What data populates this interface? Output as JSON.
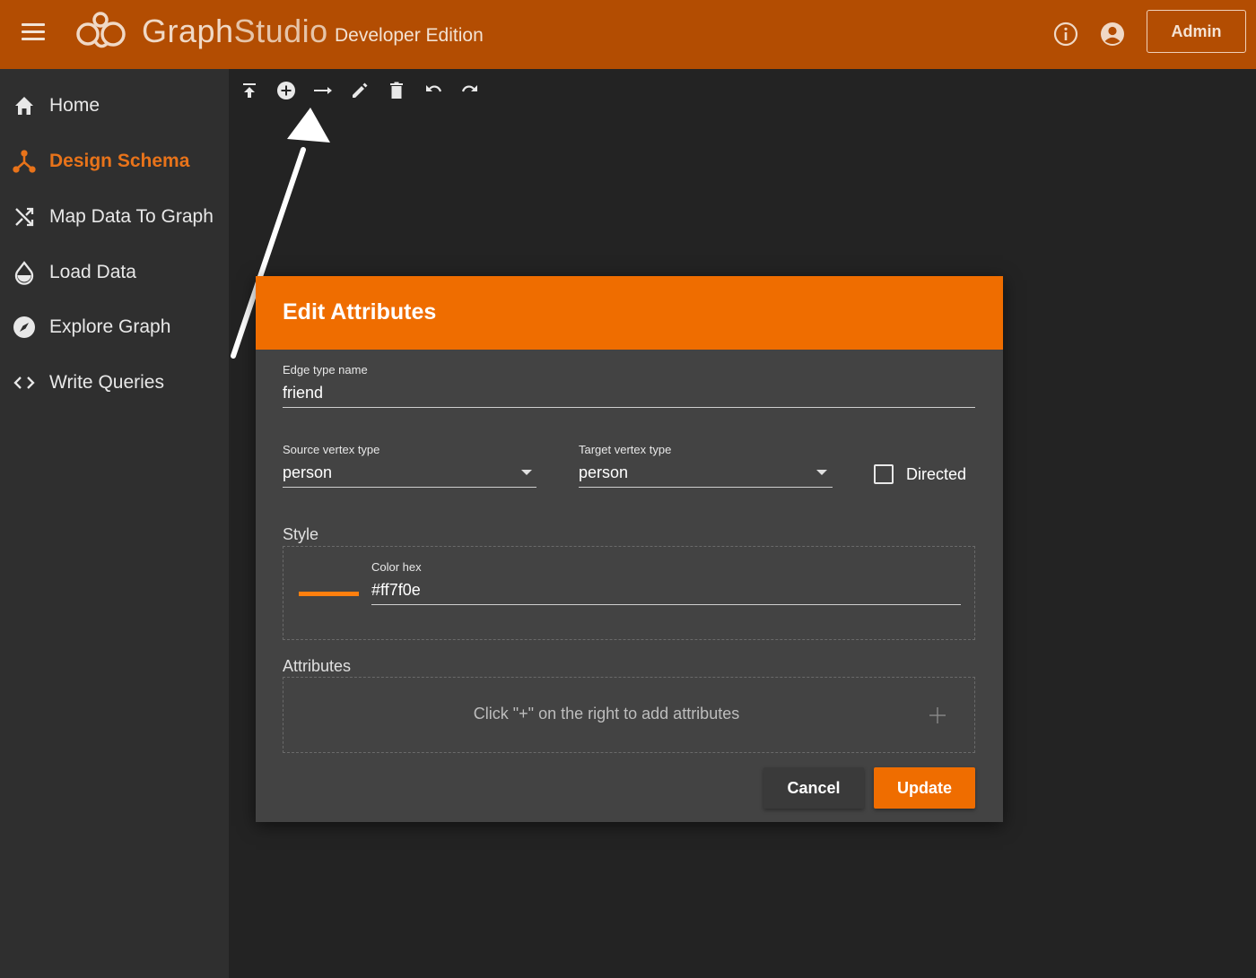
{
  "header": {
    "logo_text_bold": "Graph",
    "logo_text_light": "Studio",
    "edition": "Developer Edition",
    "admin_label": "Admin",
    "brand_color": "#b34d02"
  },
  "sidebar": {
    "items": [
      {
        "label": "Home",
        "icon": "home-icon"
      },
      {
        "label": "Design Schema",
        "icon": "schema-icon",
        "active": true
      },
      {
        "label": "Map Data To Graph",
        "icon": "shuffle-icon"
      },
      {
        "label": "Load Data",
        "icon": "drop-icon"
      },
      {
        "label": "Explore Graph",
        "icon": "compass-icon"
      },
      {
        "label": "Write Queries",
        "icon": "code-icon"
      }
    ],
    "active_color": "#e8731a"
  },
  "toolbar": {
    "icons": [
      "publish-icon",
      "add-vertex-icon",
      "add-edge-icon",
      "edit-icon",
      "delete-icon",
      "undo-icon",
      "redo-icon"
    ]
  },
  "dialog": {
    "title": "Edit Attributes",
    "edge_type_label": "Edge type name",
    "edge_type_value": "friend",
    "source_label": "Source vertex type",
    "source_value": "person",
    "target_label": "Target vertex type",
    "target_value": "person",
    "directed_label": "Directed",
    "directed_checked": false,
    "style_title": "Style",
    "color_label": "Color hex",
    "color_value": "#ff7f0e",
    "attributes_title": "Attributes",
    "attributes_empty": "Click \"+\" on the right to add attributes",
    "cancel_label": "Cancel",
    "update_label": "Update",
    "header_color": "#ef6d00"
  }
}
